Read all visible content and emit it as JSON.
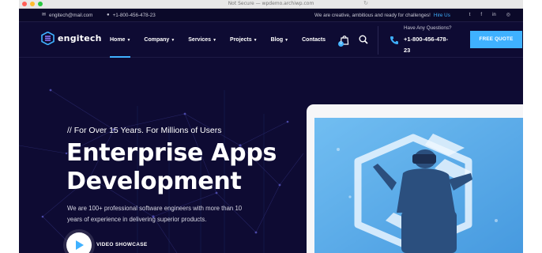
{
  "browser": {
    "url": "Not Secure — wpdemo.archiwp.com"
  },
  "topbar": {
    "email": "engitech@mail.com",
    "phone": "+1-800-456-478-23",
    "tagline": "We are creative, ambitious and ready for challenges!",
    "hire_link": "Hire Us",
    "socials": [
      "twitter-icon",
      "facebook-icon",
      "linkedin-icon",
      "instagram-icon"
    ]
  },
  "nav": {
    "logo": "engitech",
    "items": [
      {
        "label": "Home",
        "active": true
      },
      {
        "label": "Company",
        "active": false
      },
      {
        "label": "Services",
        "active": false
      },
      {
        "label": "Projects",
        "active": false
      },
      {
        "label": "Blog",
        "active": false
      },
      {
        "label": "Contacts",
        "active": false
      }
    ],
    "cart_count": "0",
    "questions": "Have Any Questions?",
    "phone": "+1-800-456-478-23",
    "quote_button": "FREE QUOTE"
  },
  "hero": {
    "eyebrow": "// For Over 15 Years. For Millions of Users",
    "title_line1": "Enterprise Apps",
    "title_line2": "Development",
    "description": "We are 100+ professional software engineers with more than 10 years of experience in delivering superior products.",
    "video_label": "VIDEO SHOWCASE"
  },
  "colors": {
    "accent": "#3fb1ff",
    "background": "#0e0b33",
    "topbar": "#0b0929"
  }
}
